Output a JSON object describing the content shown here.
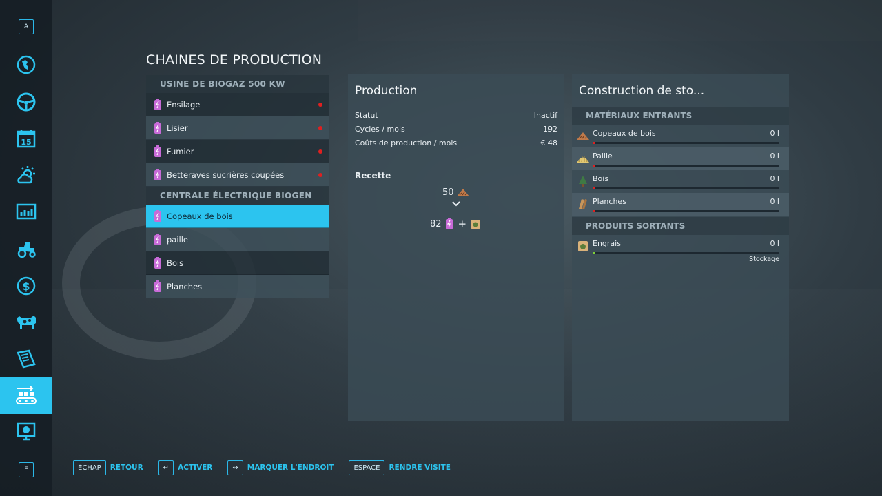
{
  "sidebar": {
    "top_key": "A",
    "bottom_key": "E",
    "items": [
      {
        "icon": "globe-map-icon"
      },
      {
        "icon": "steering-wheel-icon"
      },
      {
        "icon": "calendar-icon",
        "label": "15"
      },
      {
        "icon": "weather-icon"
      },
      {
        "icon": "statistics-icon"
      },
      {
        "icon": "tractor-icon"
      },
      {
        "icon": "finances-icon"
      },
      {
        "icon": "animals-icon"
      },
      {
        "icon": "contracts-icon"
      },
      {
        "icon": "production-chains-icon",
        "active": true
      },
      {
        "icon": "tutorial-icon"
      }
    ]
  },
  "page_title": "CHAINES DE PRODUCTION",
  "productions": [
    {
      "name": "USINE DE BIOGAZ 500 KW",
      "items": [
        {
          "label": "Ensilage",
          "status": "inactive"
        },
        {
          "label": "Lisier",
          "status": "inactive"
        },
        {
          "label": "Fumier",
          "status": "inactive"
        },
        {
          "label": "Betteraves sucrières coupées",
          "status": "inactive"
        }
      ]
    },
    {
      "name": "CENTRALE ÉLECTRIQUE BIOGEN",
      "items": [
        {
          "label": "Copeaux de bois",
          "selected": true
        },
        {
          "label": "paille"
        },
        {
          "label": "Bois"
        },
        {
          "label": "Planches"
        }
      ]
    }
  ],
  "production_panel": {
    "title": "Production",
    "stats": [
      {
        "label": "Statut",
        "value": "Inactif"
      },
      {
        "label": "Cycles / mois",
        "value": "192"
      },
      {
        "label": "Coûts de production / mois",
        "value": "€ 48"
      }
    ],
    "recipe_title": "Recette",
    "recipe_input": "50",
    "recipe_output": "82",
    "recipe_plus": "+"
  },
  "storage_panel": {
    "title": "Construction de sto...",
    "inputs_header": "MATÉRIAUX ENTRANTS",
    "inputs": [
      {
        "label": "Copeaux de bois",
        "value": "0 l",
        "icon": "woodchips-icon"
      },
      {
        "label": "Paille",
        "value": "0 l",
        "icon": "straw-icon"
      },
      {
        "label": "Bois",
        "value": "0 l",
        "icon": "tree-icon"
      },
      {
        "label": "Planches",
        "value": "0 l",
        "icon": "planks-icon"
      }
    ],
    "outputs_header": "PRODUITS SORTANTS",
    "outputs": [
      {
        "label": "Engrais",
        "value": "0 l",
        "mode": "Stockage",
        "icon": "fertilizer-icon"
      }
    ]
  },
  "hints": [
    {
      "key": "ÉCHAP",
      "label": "RETOUR"
    },
    {
      "key": "↵",
      "label": "ACTIVER"
    },
    {
      "key": "↔",
      "label": "MARQUER L'ENDROIT"
    },
    {
      "key": "ESPACE",
      "label": "RENDRE VISITE"
    }
  ],
  "colors": {
    "accent": "#2cc4ef",
    "status_inactive": "#e02020",
    "fill_ok": "#7fcf3a"
  }
}
